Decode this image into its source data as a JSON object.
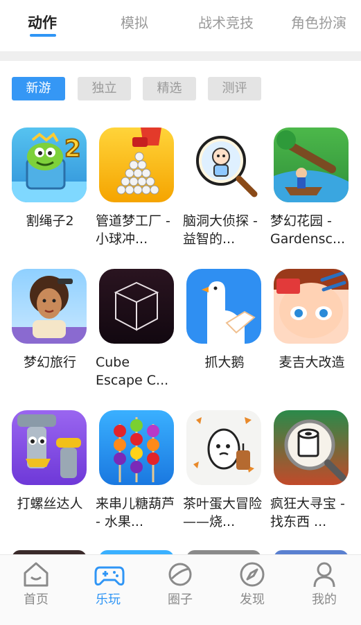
{
  "category_tabs": [
    {
      "label": "动作",
      "active": true
    },
    {
      "label": "模拟",
      "active": false
    },
    {
      "label": "战术竞技",
      "active": false
    },
    {
      "label": "角色扮演",
      "active": false
    }
  ],
  "filters": [
    {
      "label": "新游",
      "active": true
    },
    {
      "label": "独立",
      "active": false
    },
    {
      "label": "精选",
      "active": false
    },
    {
      "label": "测评",
      "active": false
    }
  ],
  "apps": [
    {
      "name": "割绳子2",
      "icon": "cut-the-rope-icon"
    },
    {
      "name": "管道梦工厂 - 小球冲...",
      "icon": "pipe-factory-icon"
    },
    {
      "name": "脑洞大侦探 - 益智的...",
      "icon": "brain-detective-icon"
    },
    {
      "name": "梦幻花园 - Gardensc...",
      "icon": "gardenscapes-icon"
    },
    {
      "name": "梦幻旅行",
      "icon": "dream-travel-icon"
    },
    {
      "name": "Cube Escape C...",
      "icon": "cube-escape-icon"
    },
    {
      "name": "抓大鹅",
      "icon": "catch-goose-icon"
    },
    {
      "name": "麦吉大改造",
      "icon": "makeover-icon"
    },
    {
      "name": "打螺丝达人",
      "icon": "screw-master-icon"
    },
    {
      "name": "来串儿糖葫芦 - 水果...",
      "icon": "candied-fruit-icon"
    },
    {
      "name": "茶叶蛋大冒险——烧...",
      "icon": "tea-egg-icon"
    },
    {
      "name": "疯狂大寻宝 - 找东西 ...",
      "icon": "treasure-hunt-icon"
    }
  ],
  "bottom_nav": [
    {
      "label": "首页",
      "icon": "home-icon",
      "active": false
    },
    {
      "label": "乐玩",
      "icon": "gamepad-icon",
      "active": true
    },
    {
      "label": "圈子",
      "icon": "planet-icon",
      "active": false
    },
    {
      "label": "发现",
      "icon": "compass-icon",
      "active": false
    },
    {
      "label": "我的",
      "icon": "user-icon",
      "active": false
    }
  ],
  "colors": {
    "accent": "#2f95f5",
    "filter_active": "#3597f5",
    "inactive_text": "#9a9a9a"
  }
}
